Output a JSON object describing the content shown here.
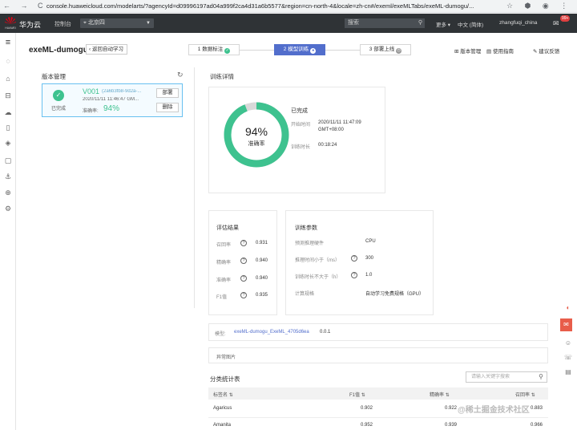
{
  "browser": {
    "nav": "← → C",
    "url": "console.huaweicloud.com/modelarts/?agencyId=d09996197ad04a999f2ca4d31a6b5577&region=cn-north-4&locale=zh-cn#/exeml/exeMLTabs/exeML-dumogu/..."
  },
  "topbar": {
    "brand": "华为云",
    "logo_text": "HUAWEI",
    "console": "控制台",
    "region": "北京四",
    "search_placeholder": "搜索",
    "more": "更多",
    "lang": "中文 (简体)",
    "user": "zhangfuqi_china",
    "mail_badge": "99+"
  },
  "page": {
    "title": "exeML-dumogu",
    "back": "返回自动学习"
  },
  "steps": [
    {
      "label": "1 数据标注"
    },
    {
      "label": "2 模型训练"
    },
    {
      "label": "3 部署上线"
    }
  ],
  "toplinks": {
    "version": "版本管理",
    "guide": "使用指南",
    "feedback": "建议反馈"
  },
  "versions": {
    "title": "版本管理",
    "item": {
      "version": "V001",
      "id": "(2a6b3fb8-9d2a-...",
      "time": "2020/11/11 11:46:47 GM...",
      "status": "已完成",
      "acc_label": "准确率:",
      "accuracy": "94%",
      "deploy": "部署",
      "delete": "删除"
    }
  },
  "training": {
    "title": "训练详情",
    "percent": "94%",
    "percent_value": 94,
    "center_label": "准确率",
    "status": "已完成",
    "start_label": "开始时间",
    "start_value_1": "2020/11/11 11:47:09",
    "start_value_2": "GMT+08:00",
    "duration_label": "训练时长",
    "duration_value": "00:18:24"
  },
  "evaluation": {
    "title": "评估结果",
    "items": [
      {
        "label": "召回率",
        "value": "0.931"
      },
      {
        "label": "精确率",
        "value": "0.940"
      },
      {
        "label": "准确率",
        "value": "0.940"
      },
      {
        "label": "F1值",
        "value": "0.935"
      }
    ]
  },
  "params": {
    "title": "训练参数",
    "items": [
      {
        "label": "预测推理硬件",
        "value": "CPU",
        "help": false
      },
      {
        "label": "推理时间小于（ms）",
        "value": "300",
        "help": true
      },
      {
        "label": "训练时长不大于（h）",
        "value": "1.0",
        "help": true
      },
      {
        "label": "计算规格",
        "value": "自动学习免费规格（GPU）",
        "help": false
      }
    ]
  },
  "model": {
    "label": "模型:",
    "name": "exeML-dumogu_ExeML_4705d6ea",
    "version": "0.0.1"
  },
  "abnormal": {
    "label": "异常图片"
  },
  "stats": {
    "title": "分类统计表",
    "search_placeholder": "请输入关键字搜索",
    "headers": [
      "标签名",
      "F1值",
      "精确率",
      "召回率"
    ],
    "rows": [
      [
        "Agaricus",
        "0.902",
        "0.922",
        "0.883"
      ],
      [
        "Amanita",
        "0.952",
        "0.939",
        "0.966"
      ]
    ]
  },
  "watermark": "@稀土掘金技术社区",
  "colors": {
    "accent": "#526ecc",
    "success": "#3ec28f",
    "topbar": "#2f3336",
    "danger": "#e85d4a"
  }
}
